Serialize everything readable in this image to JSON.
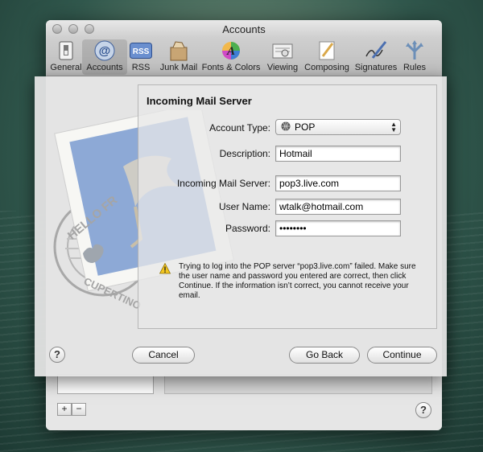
{
  "window": {
    "title": "Accounts"
  },
  "toolbar": {
    "items": [
      {
        "label": "General",
        "icon": "switch-icon"
      },
      {
        "label": "Accounts",
        "icon": "at-icon"
      },
      {
        "label": "RSS",
        "icon": "rss-icon"
      },
      {
        "label": "Junk Mail",
        "icon": "junk-mail-icon"
      },
      {
        "label": "Fonts & Colors",
        "icon": "fonts-colors-icon"
      },
      {
        "label": "Viewing",
        "icon": "viewing-icon"
      },
      {
        "label": "Composing",
        "icon": "composing-icon"
      },
      {
        "label": "Signatures",
        "icon": "signatures-icon"
      },
      {
        "label": "Rules",
        "icon": "rules-icon"
      }
    ],
    "rss_badge": "RSS",
    "at_glyph": "@"
  },
  "sheet": {
    "heading": "Incoming Mail Server",
    "account_type_label": "Account Type:",
    "account_type_value": "POP",
    "description_label": "Description:",
    "description_value": "Hotmail",
    "server_label": "Incoming Mail Server:",
    "server_value": "pop3.live.com",
    "username_label": "User Name:",
    "username_value": "wtalk@hotmail.com",
    "password_label": "Password:",
    "password_value": "••••••••",
    "warning_text": "Trying to log into the POP server “pop3.live.com” failed. Make sure the user name and password you entered are correct, then click Continue. If the information isn’t correct, you cannot receive your email.",
    "stamp_text_top": "HELLO FR",
    "stamp_text_bottom": "CUPERTINO",
    "help_label": "?",
    "cancel_label": "Cancel",
    "goback_label": "Go Back",
    "continue_label": "Continue"
  },
  "window_bottom": {
    "add_label": "+",
    "remove_label": "−",
    "help_label": "?"
  },
  "colors": {
    "warning": "#f3c620",
    "stamp_blue": "#8da9d6"
  }
}
